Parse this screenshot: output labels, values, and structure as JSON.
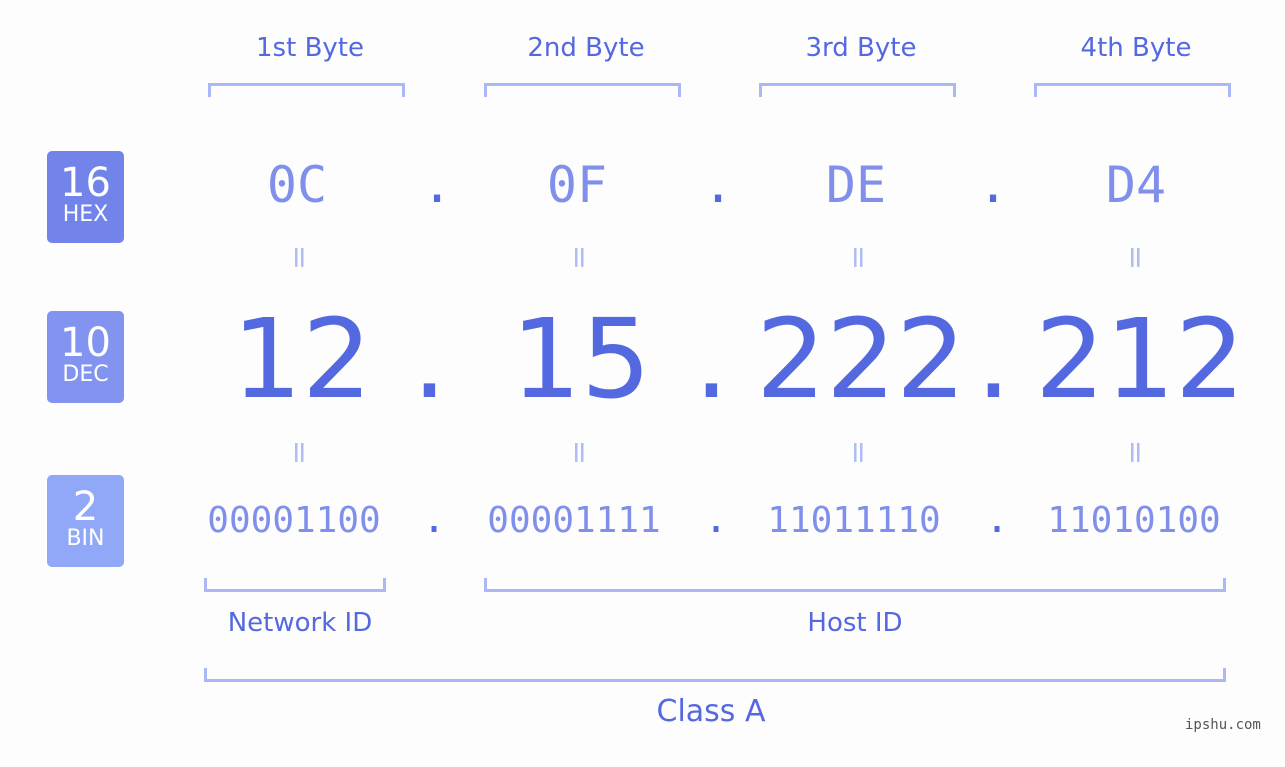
{
  "bytes": [
    {
      "label": "1st Byte",
      "hex": "0C",
      "dec": "12",
      "bin": "00001100"
    },
    {
      "label": "2nd Byte",
      "hex": "0F",
      "dec": "15",
      "bin": "00001111"
    },
    {
      "label": "3rd Byte",
      "hex": "DE",
      "dec": "222",
      "bin": "11011110"
    },
    {
      "label": "4th Byte",
      "hex": "D4",
      "dec": "212",
      "bin": "11010100"
    }
  ],
  "badges": {
    "hex": {
      "num": "16",
      "label": "HEX",
      "color": "#7283ea"
    },
    "dec": {
      "num": "10",
      "label": "DEC",
      "color": "#8293f0"
    },
    "bin": {
      "num": "2",
      "label": "BIN",
      "color": "#91a8f8"
    }
  },
  "separator": ".",
  "equals": "=",
  "network_id_label": "Network ID",
  "host_id_label": "Host ID",
  "class_label": "Class A",
  "brand": "ipshu.com"
}
